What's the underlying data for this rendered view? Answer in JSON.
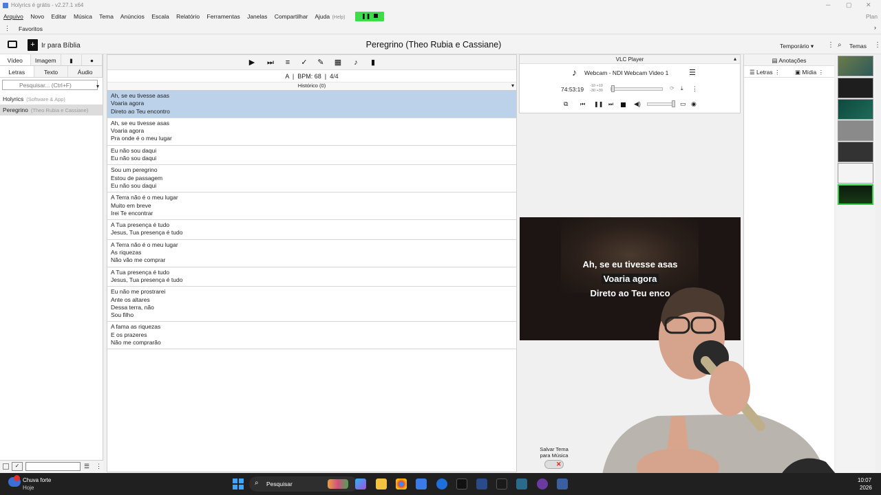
{
  "window": {
    "title": "Holyrics é grátis - v2.27.1 x64"
  },
  "menu": {
    "items": [
      "Arquivo",
      "Novo",
      "Editar",
      "Música",
      "Tema",
      "Anúncios",
      "Escala",
      "Relatório",
      "Ferramentas",
      "Janelas",
      "Compartilhar",
      "Ajuda"
    ],
    "help_tag": "(Help)",
    "plan_label": "Plan"
  },
  "favorites": {
    "label": "Favoritos"
  },
  "toolbar": {
    "bible_button": "Ir para Bíblia",
    "song_title": "Peregrino  (Theo Rubia e Cassiane)",
    "temporary_label": "Temporário",
    "themes_label": "Temas"
  },
  "left_panel": {
    "tabs_top": [
      "Vídeo",
      "Imagem"
    ],
    "tabs_bottom": [
      "Letras",
      "Texto",
      "Áudio"
    ],
    "search_placeholder": "Pesquisar... (Ctrl+F)",
    "songs": [
      {
        "title": "Holyrics",
        "sub": "(Software & App)"
      },
      {
        "title": "Peregrino",
        "sub": "(Theo Rubia e Cassiane)"
      }
    ]
  },
  "center": {
    "key": "A",
    "bpm": "BPM: 68",
    "time_sig": "4/4",
    "history": "Histórico (0)",
    "slides": [
      [
        "Ah, se eu tivesse asas",
        "Voaria agora",
        "Direto ao Teu encontro"
      ],
      [
        "Ah, se eu tivesse asas",
        "Voaria agora",
        "Pra onde é o meu lugar"
      ],
      [
        "Eu não sou daqui",
        "Eu não sou daqui"
      ],
      [
        "Sou um peregrino",
        "Estou de passagem",
        "Eu não sou daqui"
      ],
      [
        "A Terra não é o meu lugar",
        "Muito em breve",
        "Irei Te encontrar"
      ],
      [
        "A Tua presença é tudo",
        "Jesus, Tua presença é tudo"
      ],
      [
        "A Terra não é o meu lugar",
        "As riquezas",
        "Não vão me comprar"
      ],
      [
        "A Tua presença é tudo",
        "Jesus, Tua presença é tudo"
      ],
      [
        "Eu não me prostrarei",
        "Ante os altares",
        "Dessa terra, não",
        "Sou filho"
      ],
      [
        "A fama as riquezas",
        "E os prazeres",
        "Não me comprarão"
      ]
    ],
    "active_slide": 0
  },
  "vlc": {
    "title": "VLC Player",
    "source": "Webcam - NDI Webcam Video 1",
    "time": "74:53:19",
    "offsets_top": "-10 +10",
    "offsets_bottom": "-30 +30"
  },
  "preview": {
    "lines": [
      "Ah, se eu tivesse asas",
      "Voaria agora",
      "Direto ao Teu enco"
    ]
  },
  "right_panel": {
    "annotations": "Anotações",
    "lyrics_tab": "Letras",
    "media_tab": "Mídia",
    "save_theme": "Salvar Tema para Música"
  },
  "taskbar": {
    "weather": "Chuva forte",
    "weather_sub": "Hoje",
    "search": "Pesquisar",
    "clock_time": "10:07",
    "clock_date": "2026"
  },
  "colors": {
    "active_slide": "#bcd2ea",
    "play_button": "#3ddc4a",
    "taskbar": "#202020"
  }
}
